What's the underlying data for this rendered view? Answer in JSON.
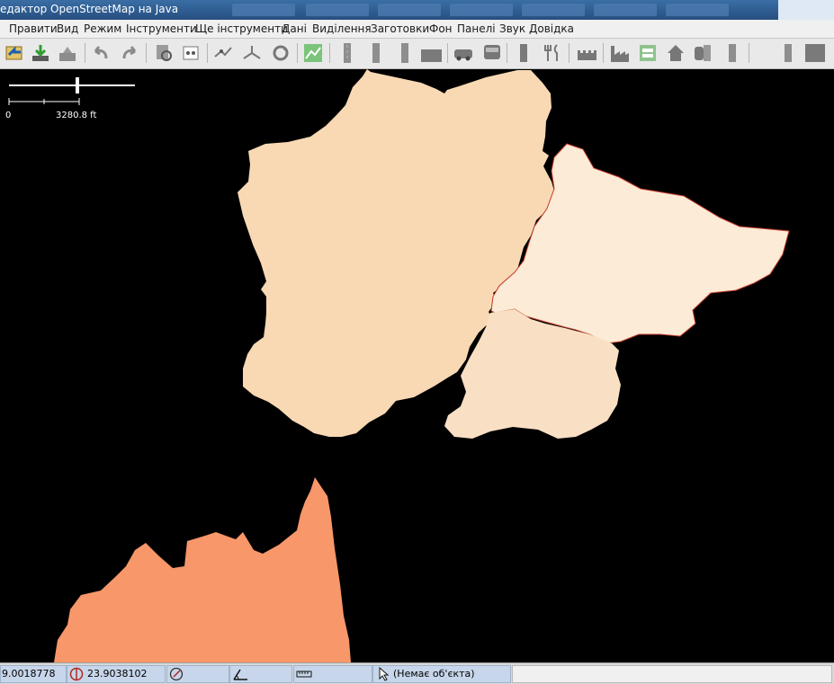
{
  "window": {
    "title": "едактор OpenStreetMap на Java"
  },
  "menu": [
    "Правити",
    "Вид",
    "Режим",
    "Інструменти",
    "Ще інструменти",
    "Дані",
    "Виділення",
    "Заготовки",
    "Фон",
    "Панелі",
    "Звук",
    "Довідка"
  ],
  "toolbar": {
    "buttons": [
      "open-icon",
      "download-icon",
      "upload-icon",
      "undo-icon",
      "redo-icon",
      "search-icon",
      "preferences-icon",
      "split-way-icon",
      "combine-way-icon",
      "refresh-icon",
      "wireframe-icon",
      "highway-icon",
      "road-icon",
      "area-icon",
      "car-icon",
      "bus-icon",
      "traffic-light-icon",
      "restaurant-icon",
      "castle-icon",
      "factory-icon",
      "parking-icon",
      "house-icon",
      "shop-icon",
      "barrier-icon",
      "door-icon",
      "wall-icon"
    ]
  },
  "map": {
    "scale": {
      "zero_label": "0",
      "distance_label": "3280.8 ft"
    },
    "colors": {
      "background": "#000000",
      "area_main": "#f8d9b4",
      "area_light": "#fcebd6",
      "area_south": "#f9e0c4",
      "area_orange": "#f7976a",
      "border_red": "#c0392b"
    }
  },
  "status": {
    "latitude": "9.0018778",
    "longitude": "23.9038102",
    "heading": "",
    "angle": "",
    "distance": "",
    "selection": "(Немає об'єкта)"
  }
}
